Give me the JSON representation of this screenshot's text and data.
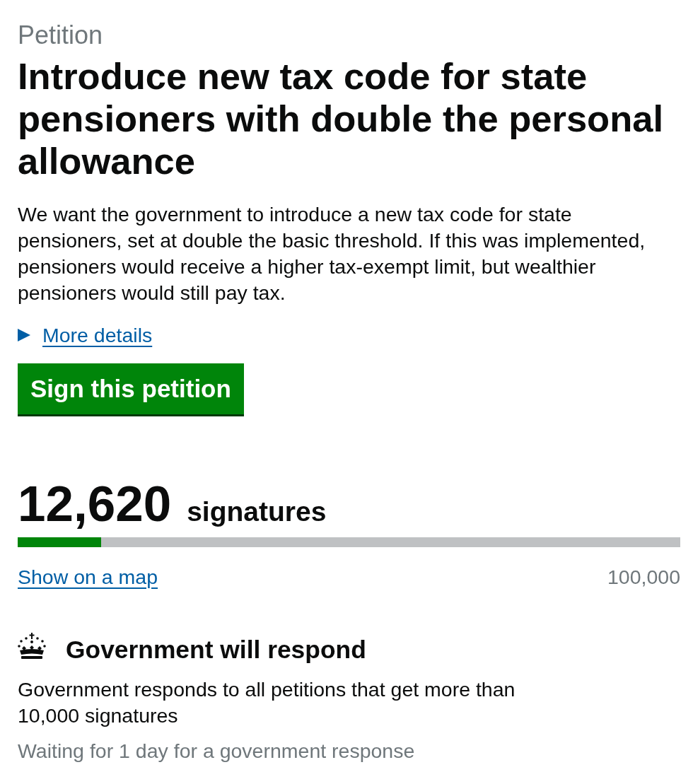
{
  "caption": "Petition",
  "title": "Introduce new tax code for state pensioners with double the personal allowance",
  "summary": "We want the government to introduce a new tax code for state pensioners, set at double the basic threshold. If this was implemented, pensioners would receive a higher tax-exempt limit, but wealthier pensioners would still pay tax.",
  "details": {
    "label": "More details",
    "expanded": false
  },
  "sign_button": "Sign this petition",
  "signatures": {
    "count": "12,620",
    "label": "signatures",
    "progress": {
      "level": 0.1262
    },
    "map_link": "Show on a map",
    "target": "100,000"
  },
  "response": {
    "heading": "Government will respond",
    "text": "Government responds to all petitions that get more than 10,000 signatures",
    "status": "Waiting for 1 day for a government response"
  }
}
